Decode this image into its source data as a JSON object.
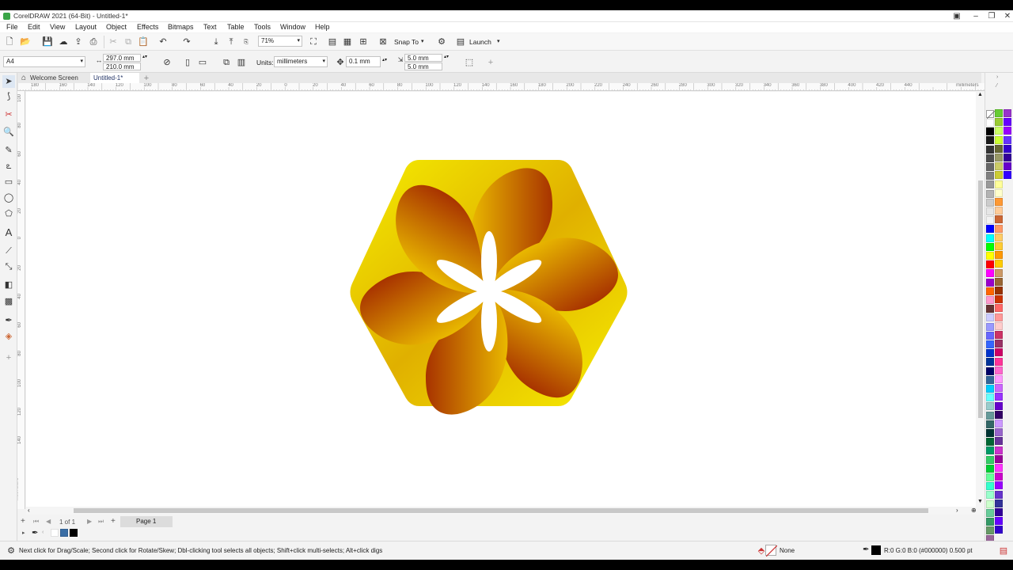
{
  "window": {
    "title": "CorelDRAW 2021 (64-Bit) - Untitled-1*",
    "controls": [
      "restore-icon",
      "minimize-icon",
      "maximize-icon",
      "close-icon"
    ]
  },
  "menu": [
    "File",
    "Edit",
    "View",
    "Layout",
    "Object",
    "Effects",
    "Bitmaps",
    "Text",
    "Table",
    "Tools",
    "Window",
    "Help"
  ],
  "toolbar": {
    "zoom": "71%",
    "snap_to": "Snap To",
    "launch": "Launch"
  },
  "property_bar": {
    "page_size": "A4",
    "width": "297.0 mm",
    "height": "210.0 mm",
    "units_label": "Units:",
    "units": "millimeters",
    "nudge": "0.1 mm",
    "dup_x": "5.0 mm",
    "dup_y": "5.0 mm"
  },
  "tabs": {
    "welcome": "Welcome Screen",
    "document": "Untitled-1*"
  },
  "ruler": {
    "h_labels": [
      "180",
      "160",
      "140",
      "120",
      "100",
      "80",
      "60",
      "40",
      "20",
      "0",
      "20",
      "40",
      "60",
      "80",
      "100",
      "120",
      "140",
      "160",
      "180",
      "200",
      "220",
      "240",
      "260",
      "280",
      "300",
      "320",
      "340",
      "360",
      "380",
      "400",
      "420",
      "440"
    ],
    "h_unit": "millimeters",
    "v_labels": [
      "100",
      "80",
      "60",
      "40",
      "20",
      "0",
      "20",
      "40",
      "60",
      "80",
      "100",
      "120",
      "140"
    ],
    "v_unit": "millimeters"
  },
  "pages": {
    "counter": "1 of 1",
    "page_tab": "Page 1"
  },
  "status": {
    "hint": "Next click for Drag/Scale; Second click for Rotate/Skew; Dbl-clicking tool selects all objects; Shift+click multi-selects; Alt+click digs",
    "fill_label": "None",
    "outline": "R:0 G:0 B:0 (#000000)  0.500 pt"
  },
  "palette_colors": [
    "#ffffff",
    "#000000",
    "#1a1a1a",
    "#333333",
    "#4d4d4d",
    "#666666",
    "#808080",
    "#999999",
    "#b3b3b3",
    "#cccccc",
    "#e6e6e6",
    "#f2f2f2",
    "#0000ff",
    "#00ffff",
    "#00ff00",
    "#ffff00",
    "#ff0000",
    "#ff00ff",
    "#9900cc",
    "#ff6600",
    "#ff99cc",
    "#663333",
    "#ccccff",
    "#9999ff",
    "#6666ff",
    "#3366ff",
    "#0033cc",
    "#003399",
    "#000066",
    "#336699",
    "#00ccff",
    "#66ffff",
    "#99cccc",
    "#669999",
    "#336666",
    "#003333",
    "#006633",
    "#009966",
    "#33cc66",
    "#00cc33",
    "#66ff99",
    "#33ffcc",
    "#99ffcc",
    "#ccffcc",
    "#66cc99",
    "#339966",
    "#669966",
    "#996699"
  ],
  "palette_colors_2": [
    "#66cc33",
    "#99cc33",
    "#ccff66",
    "#ccff33",
    "#666633",
    "#999966",
    "#cccc66",
    "#cccc33",
    "#ffff99",
    "#ffffcc",
    "#ff9933",
    "#ffcc99",
    "#cc6633",
    "#ff9966",
    "#ffcc66",
    "#ffcc33",
    "#ff9900",
    "#ffcc00",
    "#cc9966",
    "#996633",
    "#993300",
    "#cc3300",
    "#ff6666",
    "#ff9999",
    "#ffcccc",
    "#cc3366",
    "#993366",
    "#cc0066",
    "#ff3399",
    "#ff66cc",
    "#ff99ff",
    "#cc66ff",
    "#9933ff",
    "#6600cc",
    "#330066",
    "#cc99ff",
    "#9966cc",
    "#663399",
    "#cc33cc",
    "#990099",
    "#ff33ff",
    "#cc00cc",
    "#9900ff",
    "#6633cc",
    "#333399",
    "#330099",
    "#6600ff",
    "#3300cc"
  ],
  "palette_colors_3": [
    "#9933cc",
    "#6600ff",
    "#9900ff",
    "#6633ff",
    "#3300cc",
    "#330099",
    "#6600cc",
    "#3300ff"
  ]
}
